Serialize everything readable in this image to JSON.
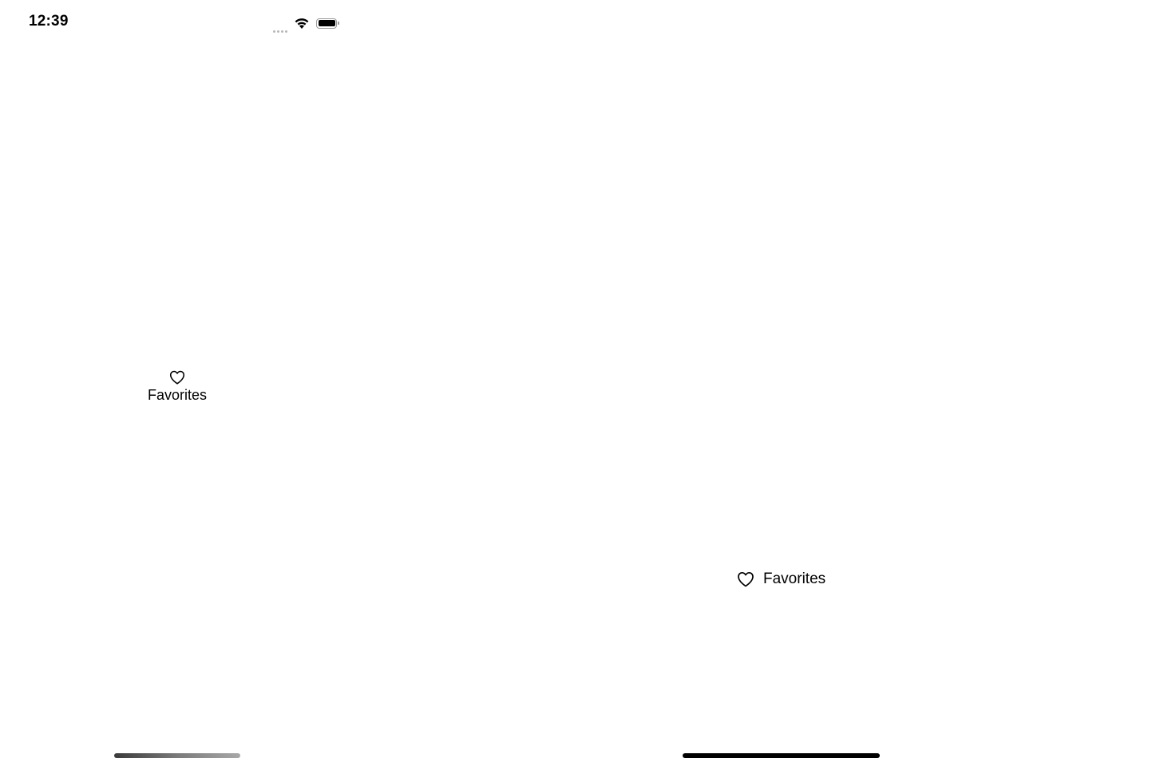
{
  "status_bar": {
    "time": "12:39",
    "icons": [
      "signal-dots-icon",
      "wifi-icon",
      "battery-icon"
    ]
  },
  "portrait_tab": {
    "icon": "heart-icon",
    "label": "Favorites"
  },
  "landscape_tab": {
    "icon": "heart-icon",
    "label": "Favorites"
  },
  "colors": {
    "background": "#ffffff",
    "text": "#000000",
    "signal_inactive": "#b8b8b8"
  }
}
